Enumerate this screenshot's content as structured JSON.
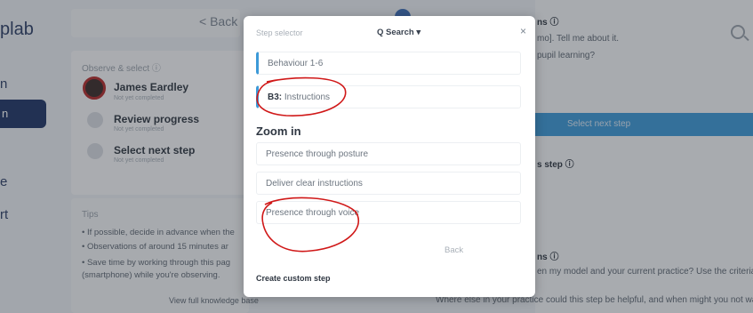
{
  "background": {
    "brand": "plab",
    "sidebar": {
      "item_1": "n",
      "item_2": "e",
      "item_3": "rt"
    },
    "back_link": "< Back",
    "observe": {
      "title": "Observe & select ⓘ",
      "teacher_name": "James Eardley",
      "teacher_status": "Not yet completed",
      "steps": [
        {
          "name": "Review progress",
          "status": "Not yet completed"
        },
        {
          "name": "Select next step",
          "status": "Not yet completed"
        }
      ]
    },
    "tips": {
      "title": "Tips",
      "items": [
        "• If possible, decide in advance when the",
        "• Observations of around 15 minutes ar",
        "• Save time by working through this pag",
        "  (smartphone) while you're observing."
      ],
      "kb_link": "View full knowledge base"
    },
    "right": {
      "heading_1": "ns ⓘ",
      "line_1": "mo]. Tell me about it.",
      "line_2": "pupil learning?",
      "select_next_button": "Select next step",
      "heading_2": "s step ⓘ",
      "heading_3": "ns ⓘ",
      "line_3": "en my model and your current practice? Use the criteria to he",
      "line_4": "Where else in your practice could this step be helpful, and when might you not want to us"
    }
  },
  "modal": {
    "title": "Step selector",
    "search_label": "Q Search ▾",
    "close_label": "×",
    "items_top": [
      {
        "label": "Behaviour 1-6",
        "prefix": ""
      },
      {
        "label": " Instructions",
        "prefix": "B3:"
      }
    ],
    "zoom_heading": "Zoom in",
    "zoom_items": [
      "Presence through posture",
      "Deliver clear instructions",
      "Presence through voice"
    ],
    "back_label": "Back",
    "custom_label": "Create custom step"
  },
  "colors": {
    "accent_blue": "#3d9ad8",
    "nav_navy": "#1f3566",
    "scribble_red": "#d01818"
  }
}
